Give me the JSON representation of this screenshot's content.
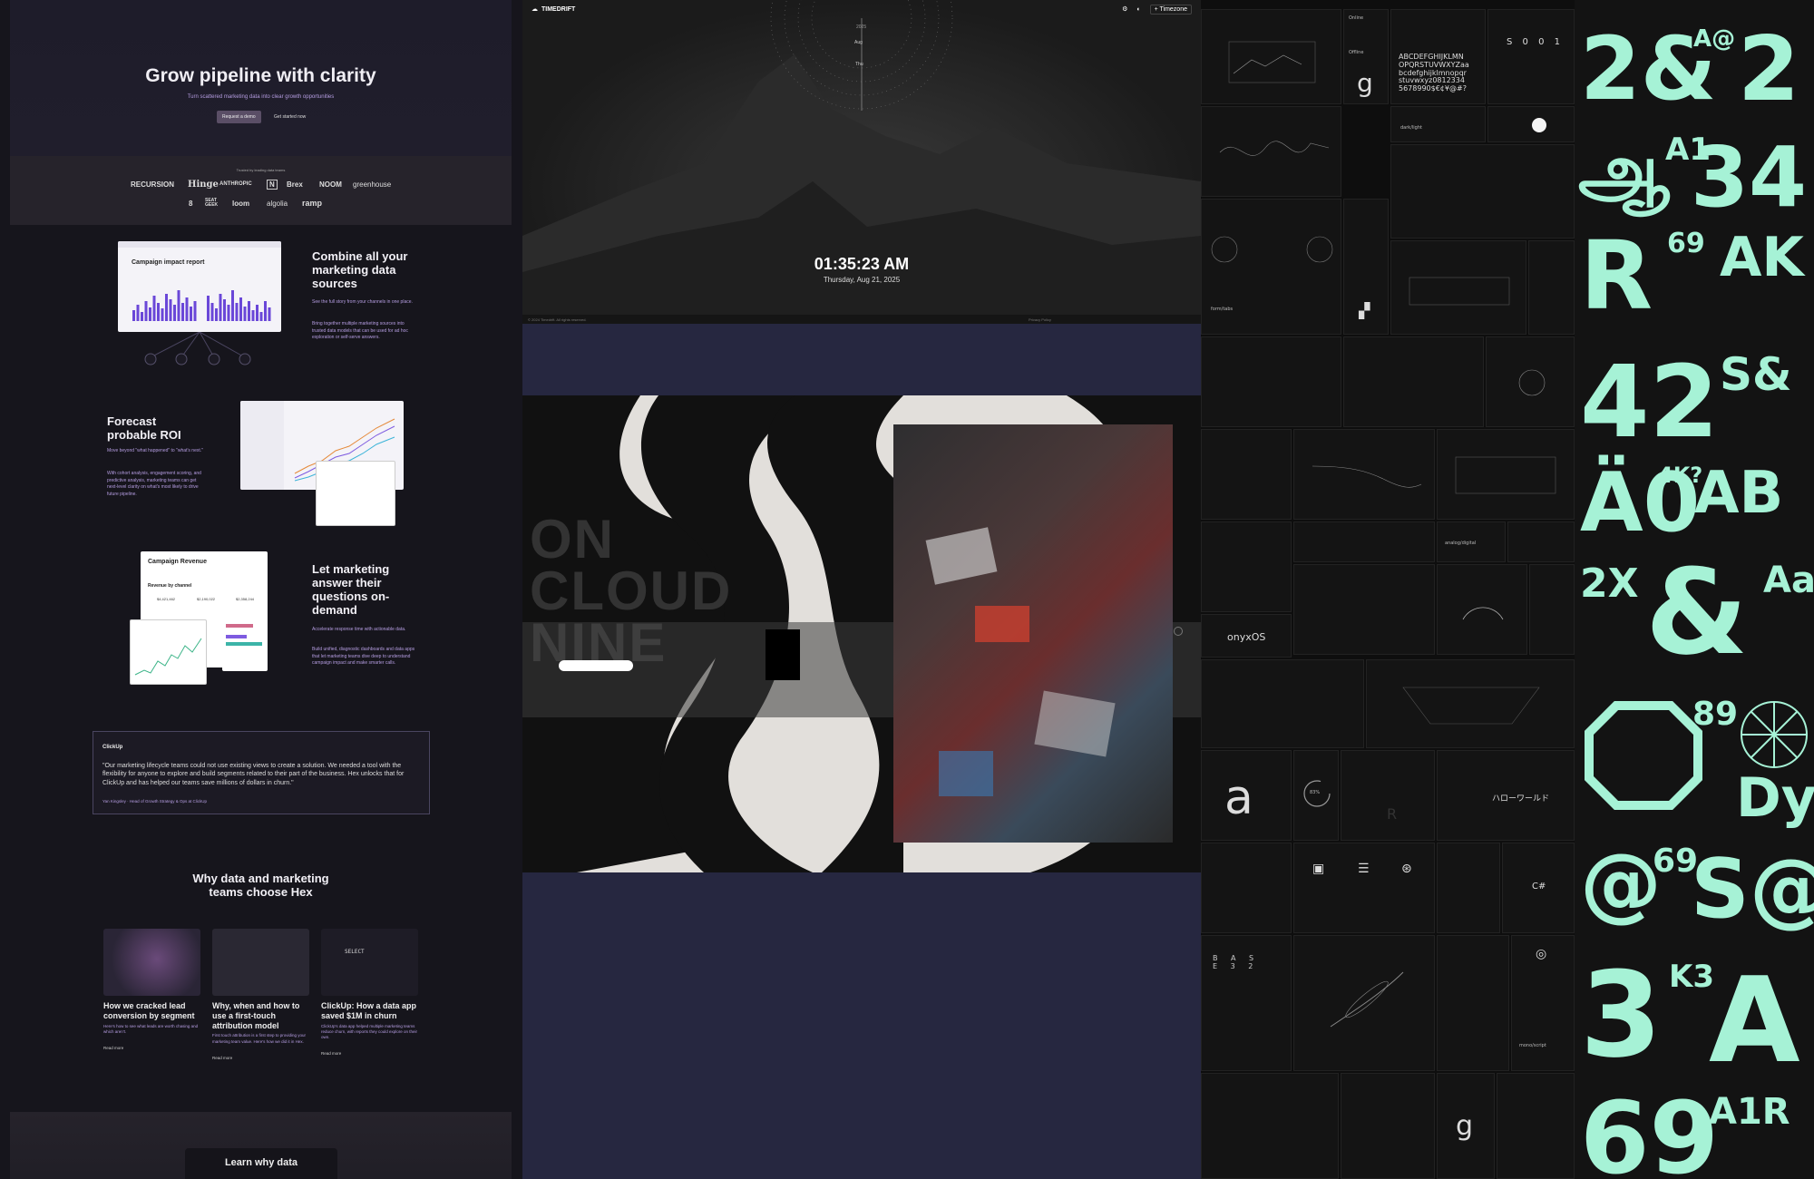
{
  "hex": {
    "hero_title": "Grow pipeline with clarity",
    "hero_sub": "Turn scattered marketing data into clear growth opportunities",
    "btn_primary": "Request a demo",
    "btn_secondary": "Get started now",
    "trusted": "Trusted by leading data teams",
    "logos_row1": [
      "RECURSION",
      "Hinge",
      "ANTHROPIC",
      "N",
      "Brex",
      "NOOM",
      "greenhouse"
    ],
    "logos_row2": [
      "8",
      "SEAT GEEK",
      "loom",
      "algolia",
      "ramp"
    ],
    "f1_title": "Combine all your\nmarketing data\nsources",
    "f1_d1": "See the full story from your channels in one place.",
    "f1_d2": "Bring together multiple marketing sources into trusted data models that can be used for ad hoc exploration or self-serve answers.",
    "f1_report": "Campaign impact report",
    "f2_title": "Forecast\nprobable ROI",
    "f2_d1": "Move beyond \"what happened\" to \"what's next.\"",
    "f2_d2": "With cohort analysis, engagement scoring, and predictive analysis, marketing teams can get next-level clarity on what's most likely to drive future pipeline.",
    "f3_title": "Let marketing\nanswer their\nquestions on-\ndemand",
    "f3_d1": "Accelerate response time with actionable data.",
    "f3_d2": "Build unified, diagnostic dashboards and data apps that let marketing teams dive deep to understand campaign impact and make smarter calls.",
    "f3_report": "Campaign Revenue",
    "f3_sub": "Revenue by channel",
    "f3_stats": [
      "$4,421,462",
      "$2,190,022",
      "$2,358,244"
    ],
    "quote_brand": "ClickUp",
    "quote_text": "\"Our marketing lifecycle teams could not use existing views to create a solution. We needed a tool with the flexibility for anyone to explore and build segments related to their part of the business. Hex unlocks that for ClickUp and has helped our teams save millions of dollars in churn.\"",
    "quote_author": "Yan Kingsley · Head of Growth Strategy & Ops at ClickUp",
    "why_title": "Why data and marketing\nteams choose Hex",
    "cards": [
      {
        "title": "How we cracked lead conversion by segment",
        "desc": "Here's how to see what leads are worth chasing and which aren't.",
        "cta": "Read more"
      },
      {
        "title": "Why, when and how to use a first-touch attribution model",
        "desc": "First touch attribution is a first step to providing your marketing team value. Here's how we did it in Hex.",
        "cta": "Read more"
      },
      {
        "title": "ClickUp: How a data app saved $1M in churn",
        "desc": "ClickUp's data app helped multiple marketing teams reduce churn, with reports they could explore on their own.",
        "cta": "Read more"
      }
    ],
    "card3_code": "SELECT",
    "bottom_cta": "Learn why data"
  },
  "timedrift": {
    "brand": "TIMEDRIFT",
    "nav_btn": "Timezone",
    "time": "01:35:23 AM",
    "date": "Thursday, Aug 21, 2025",
    "copyright": "© 2024 Timedrift. All rights reserved.",
    "privacy": "Privacy Policy",
    "dial_year": "2025",
    "dial_labels": [
      "Aug",
      "Thu"
    ],
    "bg_word": "ON CLOUD NINE"
  },
  "grid": {
    "alphabet": "ABCDEFGHIJKLMN\nOPQRSTUVWXYZaa\nbcdefghijklmnopqr\nstuvwxyz0812334\n5678990$€¢¥@#?",
    "onyx": "onyxOS",
    "hello": "ハローワールド",
    "percent": "83%",
    "darklight": "dark/light",
    "analog": "analog/digital",
    "csharp": "C#",
    "g_letter": "g",
    "a_letter": "a",
    "r_letter": "R",
    "tabs": "form/tabs",
    "mono": "mono/script",
    "online": "Online",
    "offline": "Offline",
    "lock": "S 0 0 1",
    "compass": "B A S E 3 2"
  },
  "glyphs": {
    "r1a": "2&",
    "r1b": "A@",
    "r1c": "2",
    "r2a": "ஆ",
    "r2b": "A1",
    "r2c": "34",
    "r3a": "R",
    "r3b": "69",
    "r3c": "AK",
    "r4a": "42",
    "r4b": "S&",
    "r5a": "Ä0",
    "r5b": "4K?",
    "r5c": "AB",
    "r6a": "2X",
    "r6b": "&",
    "r6c": "Aa",
    "r7b": "89",
    "r7c": "Dy",
    "r8a": "@",
    "r8b": "69",
    "r8c": "S@",
    "r9a": "3",
    "r9b": "K3",
    "r9c": "A",
    "r10a": "69",
    "r10b": "A1R"
  },
  "colors": {
    "mint": "#a6f2d6",
    "hex_purple": "#b49ce0",
    "navy": "#262740"
  }
}
